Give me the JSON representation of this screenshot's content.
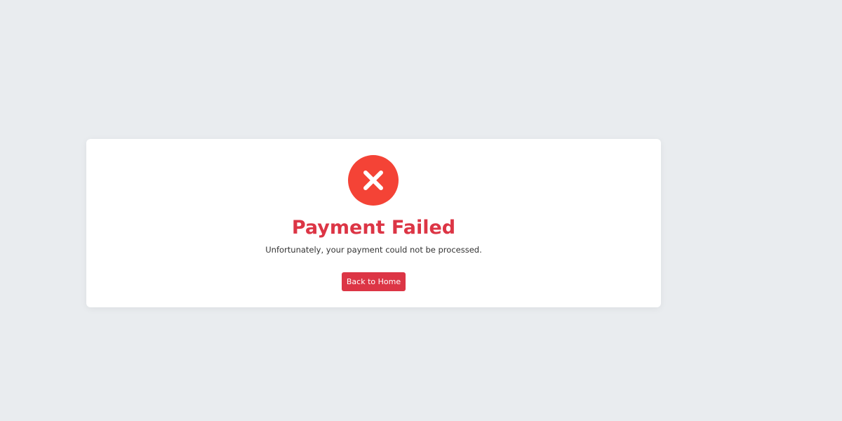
{
  "page": {
    "background_color": "#e9ecef"
  },
  "card": {
    "background_color": "#ffffff",
    "icon": {
      "name": "close-x-icon",
      "background_color": "#f44336",
      "glyph_color": "#ffffff"
    },
    "title": "Payment Failed",
    "title_color": "#dc3545",
    "message": "Unfortunately, your payment could not be processed.",
    "button": {
      "label": "Back to Home",
      "color": "#dc3545"
    }
  }
}
